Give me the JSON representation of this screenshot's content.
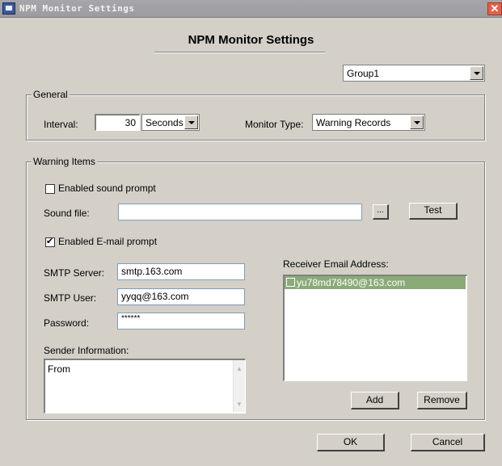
{
  "window": {
    "title": "NPM Monitor Settings",
    "close_glyph": "✕"
  },
  "heading": "NPM Monitor Settings",
  "group_select": {
    "value": "Group1"
  },
  "general": {
    "legend": "General",
    "interval_label": "Interval:",
    "interval_value": "30",
    "interval_unit": "Seconds",
    "monitor_type_label": "Monitor Type:",
    "monitor_type_value": "Warning Records"
  },
  "warning": {
    "legend": "Warning Items",
    "sound_prompt_label": "Enabled sound prompt",
    "sound_prompt_checked": false,
    "sound_file_label": "Sound file:",
    "sound_file_value": "",
    "browse_label": "...",
    "test_label": "Test",
    "email_prompt_label": "Enabled E-mail prompt",
    "email_prompt_checked": true,
    "smtp_server_label": "SMTP Server:",
    "smtp_server_value": "smtp.163.com",
    "smtp_user_label": "SMTP User:",
    "smtp_user_value": "yyqq@163.com",
    "password_label": "Password:",
    "password_value": "******",
    "sender_info_label": "Sender Information:",
    "sender_info_value": "From",
    "receiver_label": "Receiver Email Address:",
    "receivers": [
      {
        "address": "yu78md78490@163.com",
        "checked": false,
        "selected": true
      }
    ],
    "add_label": "Add",
    "remove_label": "Remove"
  },
  "footer": {
    "ok_label": "OK",
    "cancel_label": "Cancel"
  },
  "colors": {
    "dialog_bg": "#d4d0c8",
    "selection": "#8aaa78",
    "close_button": "#e0624c"
  }
}
